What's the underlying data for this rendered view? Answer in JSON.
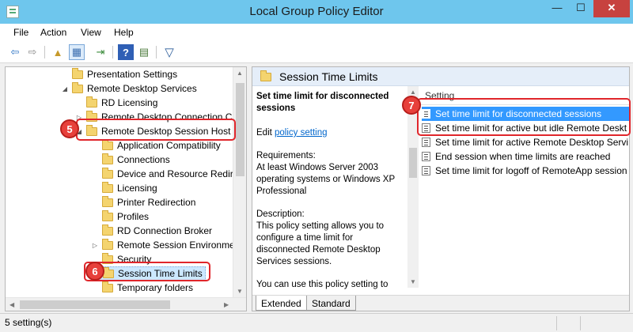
{
  "window": {
    "title": "Local Group Policy Editor",
    "minimize": "—",
    "maximize": "☐",
    "close": "✕"
  },
  "menu": [
    "File",
    "Action",
    "View",
    "Help"
  ],
  "toolbar": {
    "icons": [
      "back-icon",
      "forward-icon",
      "up-folder-icon",
      "show-hide-tree-icon",
      "export-list-icon",
      "help-icon",
      "properties-icon",
      "filter-icon"
    ],
    "glyphs": {
      "back": "⇦",
      "forward": "⇨",
      "up": "▲",
      "tree": "▦",
      "export": "⇥",
      "help": "?",
      "props": "▤",
      "filter": "▽"
    }
  },
  "tree": {
    "items": [
      {
        "label": "Presentation Settings",
        "expander": ""
      },
      {
        "label": "Remote Desktop Services",
        "expander": "◢"
      },
      {
        "label": "RD Licensing",
        "expander": ""
      },
      {
        "label": "Remote Desktop Connection Cl",
        "expander": "▷"
      },
      {
        "label": "Remote Desktop Session Host",
        "expander": "◢"
      },
      {
        "label": "Application Compatibility",
        "expander": ""
      },
      {
        "label": "Connections",
        "expander": ""
      },
      {
        "label": "Device and Resource Redire",
        "expander": ""
      },
      {
        "label": "Licensing",
        "expander": ""
      },
      {
        "label": "Printer Redirection",
        "expander": ""
      },
      {
        "label": "Profiles",
        "expander": ""
      },
      {
        "label": "RD Connection Broker",
        "expander": ""
      },
      {
        "label": "Remote Session Environmer",
        "expander": "▷"
      },
      {
        "label": "Security",
        "expander": ""
      },
      {
        "label": "Session Time Limits",
        "expander": ""
      },
      {
        "label": "Temporary folders",
        "expander": ""
      }
    ]
  },
  "details": {
    "folder_title": "Session Time Limits",
    "selected_title": "Set time limit for disconnected sessions",
    "edit_prefix": "Edit ",
    "edit_link": "policy setting",
    "requirements_label": "Requirements:",
    "requirements_text": "At least Windows Server 2003 operating systems or Windows XP Professional",
    "description_label": "Description:",
    "description_text": "This policy setting allows you to configure a time limit for disconnected Remote Desktop Services sessions.",
    "description_more": "You can use this policy setting to"
  },
  "list": {
    "column_header": "Setting",
    "rows": [
      "Set time limit for disconnected sessions",
      "Set time limit for active but idle Remote Deskt",
      "Set time limit for active Remote Desktop Servi",
      "End session when time limits are reached",
      "Set time limit for logoff of RemoteApp session"
    ]
  },
  "tabs": {
    "extended": "Extended",
    "standard": "Standard"
  },
  "status": {
    "text": "5 setting(s)"
  },
  "callouts": {
    "step5": "5",
    "step6": "6",
    "step7": "7"
  },
  "colors": {
    "title_bar": "#6ec6ed",
    "selection": "#3399ff",
    "callout": "#e0262b",
    "link": "#0066cc"
  }
}
